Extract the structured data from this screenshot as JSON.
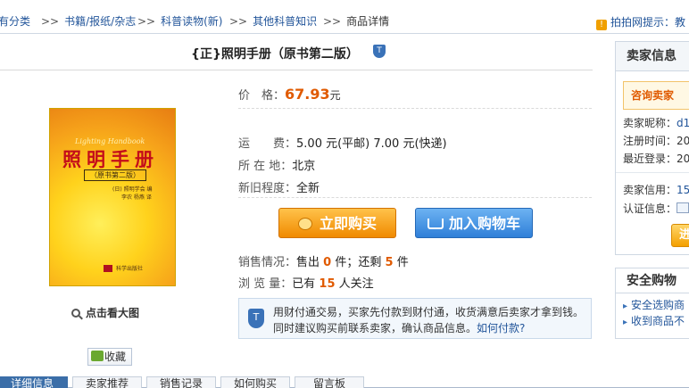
{
  "breadcrumb": {
    "items": [
      "有分类",
      "书籍/报纸/杂志",
      "科普读物(新)",
      "其他科普知识"
    ],
    "separator": ">>",
    "current": "商品详情"
  },
  "tip": "拍拍网提示：教",
  "product": {
    "title": "{正}照明手册（原书第二版）",
    "price_label": "价　格：",
    "price": "67.93",
    "price_unit": "元",
    "shipping_label": "运　　费：",
    "shipping": "5.00 元(平邮)  7.00 元(快递)",
    "location_label": "所 在 地：",
    "location": "北京",
    "condition_label": "新旧程度：",
    "condition": "全新",
    "buy_now": "立即购买",
    "add_to_cart": "加入购物车",
    "sales_label": "销售情况：",
    "sold_prefix": "售出",
    "sold_count": "0",
    "sold_mid": "件；还剩",
    "remaining": "5",
    "remaining_unit": "件",
    "views_label": "浏 览 量：",
    "views_prefix": "已有",
    "views": "15",
    "views_suffix": "人关注",
    "enlarge": "点击看大图",
    "favorite": "收藏"
  },
  "cover": {
    "subtitle_en": "Lighting Handbook",
    "title": "照明手册",
    "edition": "（原书第二版）",
    "author": "(日) 照明学会 编",
    "translator": "李农 杨燕 译",
    "publisher": "科学出版社"
  },
  "notice": {
    "line1": "用财付通交易，买家先付款到财付通，收货满意后卖家才拿到钱。",
    "line2": "同时建议购买前联系卖家，确认商品信息。",
    "link": "如何付款?"
  },
  "tabs": [
    "详细信息",
    "卖家推荐",
    "销售记录",
    "如何购买",
    "留言板"
  ],
  "seller": {
    "heading": "卖家信息",
    "consult": "咨询卖家",
    "nickname_label": "卖家昵称：",
    "nickname": "d1",
    "reg_label": "注册时间：",
    "reg": "20",
    "login_label": "最近登录：",
    "login": "20",
    "credit_label": "卖家信用：",
    "credit": "15",
    "cert_label": "认证信息：",
    "contact": "进"
  },
  "safe": {
    "heading": "安全购物",
    "item1": "安全选购商",
    "item2": "收到商品不"
  },
  "colors": {
    "link": "#22559a",
    "price": "#e05a00",
    "buy_button": "#f08a00",
    "cart_button": "#2f7fd8",
    "active_tab": "#3b6ea8"
  }
}
